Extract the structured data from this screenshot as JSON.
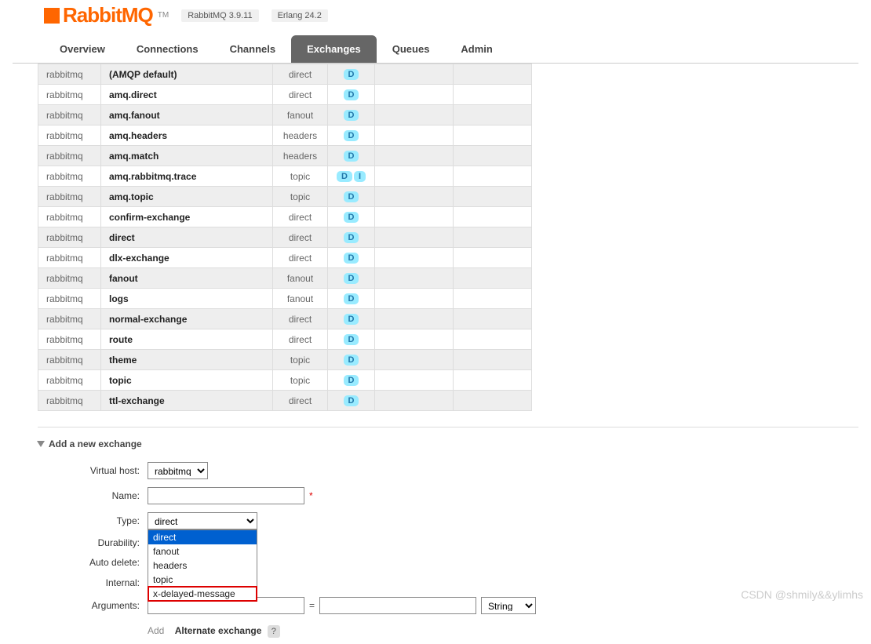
{
  "header": {
    "logo_text": "RabbitMQ",
    "tm": "TM",
    "version": "RabbitMQ 3.9.11",
    "erlang": "Erlang 24.2"
  },
  "tabs": [
    {
      "label": "Overview",
      "active": false
    },
    {
      "label": "Connections",
      "active": false
    },
    {
      "label": "Channels",
      "active": false
    },
    {
      "label": "Exchanges",
      "active": true
    },
    {
      "label": "Queues",
      "active": false
    },
    {
      "label": "Admin",
      "active": false
    }
  ],
  "exchanges": [
    {
      "vhost": "rabbitmq",
      "name": "(AMQP default)",
      "type": "direct",
      "features": [
        "D"
      ]
    },
    {
      "vhost": "rabbitmq",
      "name": "amq.direct",
      "type": "direct",
      "features": [
        "D"
      ]
    },
    {
      "vhost": "rabbitmq",
      "name": "amq.fanout",
      "type": "fanout",
      "features": [
        "D"
      ]
    },
    {
      "vhost": "rabbitmq",
      "name": "amq.headers",
      "type": "headers",
      "features": [
        "D"
      ]
    },
    {
      "vhost": "rabbitmq",
      "name": "amq.match",
      "type": "headers",
      "features": [
        "D"
      ]
    },
    {
      "vhost": "rabbitmq",
      "name": "amq.rabbitmq.trace",
      "type": "topic",
      "features": [
        "D",
        "I"
      ]
    },
    {
      "vhost": "rabbitmq",
      "name": "amq.topic",
      "type": "topic",
      "features": [
        "D"
      ]
    },
    {
      "vhost": "rabbitmq",
      "name": "confirm-exchange",
      "type": "direct",
      "features": [
        "D"
      ]
    },
    {
      "vhost": "rabbitmq",
      "name": "direct",
      "type": "direct",
      "features": [
        "D"
      ]
    },
    {
      "vhost": "rabbitmq",
      "name": "dlx-exchange",
      "type": "direct",
      "features": [
        "D"
      ]
    },
    {
      "vhost": "rabbitmq",
      "name": "fanout",
      "type": "fanout",
      "features": [
        "D"
      ]
    },
    {
      "vhost": "rabbitmq",
      "name": "logs",
      "type": "fanout",
      "features": [
        "D"
      ]
    },
    {
      "vhost": "rabbitmq",
      "name": "normal-exchange",
      "type": "direct",
      "features": [
        "D"
      ]
    },
    {
      "vhost": "rabbitmq",
      "name": "route",
      "type": "direct",
      "features": [
        "D"
      ]
    },
    {
      "vhost": "rabbitmq",
      "name": "theme",
      "type": "topic",
      "features": [
        "D"
      ]
    },
    {
      "vhost": "rabbitmq",
      "name": "topic",
      "type": "topic",
      "features": [
        "D"
      ]
    },
    {
      "vhost": "rabbitmq",
      "name": "ttl-exchange",
      "type": "direct",
      "features": [
        "D"
      ]
    }
  ],
  "section": {
    "title": "Add a new exchange"
  },
  "form": {
    "labels": {
      "vhost": "Virtual host:",
      "name": "Name:",
      "type": "Type:",
      "durability": "Durability:",
      "auto_delete": "Auto delete:",
      "internal": "Internal:",
      "arguments": "Arguments:"
    },
    "vhost_value": "rabbitmq",
    "type_value": "direct",
    "type_options": [
      {
        "label": "direct",
        "selected": true
      },
      {
        "label": "fanout",
        "selected": false
      },
      {
        "label": "headers",
        "selected": false
      },
      {
        "label": "topic",
        "selected": false
      },
      {
        "label": "x-delayed-message",
        "selected": false,
        "highlight": true
      }
    ],
    "help": "?",
    "required": "*",
    "eq": "=",
    "arg_type": "String",
    "add_text": "Add",
    "alt_exchange": "Alternate exchange"
  },
  "watermark": "CSDN @shmily&&ylimhs"
}
